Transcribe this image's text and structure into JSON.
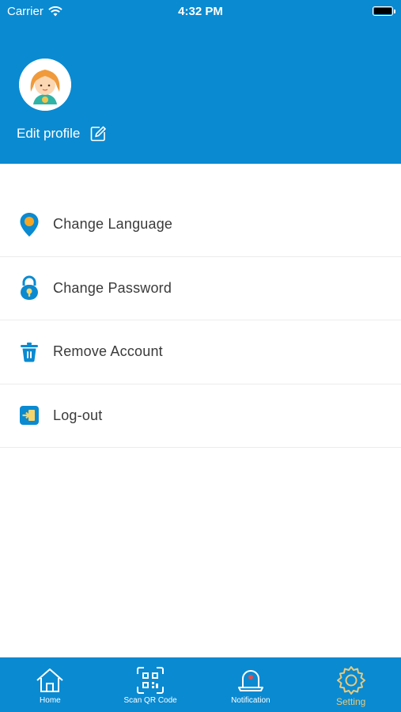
{
  "status_bar": {
    "carrier": "Carrier",
    "time": "4:32 PM"
  },
  "profile": {
    "edit_label": "Edit profile"
  },
  "menu": {
    "items": [
      {
        "label": "Change Language",
        "icon": "location-pin-icon"
      },
      {
        "label": "Change Password",
        "icon": "lock-icon"
      },
      {
        "label": "Remove Account",
        "icon": "trash-icon"
      },
      {
        "label": "Log-out",
        "icon": "logout-icon"
      }
    ]
  },
  "tabbar": {
    "tabs": [
      {
        "label": "Home",
        "icon": "home-icon"
      },
      {
        "label": "Scan QR Code",
        "icon": "qr-scan-icon"
      },
      {
        "label": "Notification",
        "icon": "bell-icon"
      },
      {
        "label": "Setting",
        "icon": "gear-icon",
        "active": true
      }
    ]
  },
  "colors": {
    "primary": "#0a8ad1",
    "active_tab": "#e9c97a",
    "text": "#3a3a3a",
    "accent_orange": "#f5a623"
  }
}
